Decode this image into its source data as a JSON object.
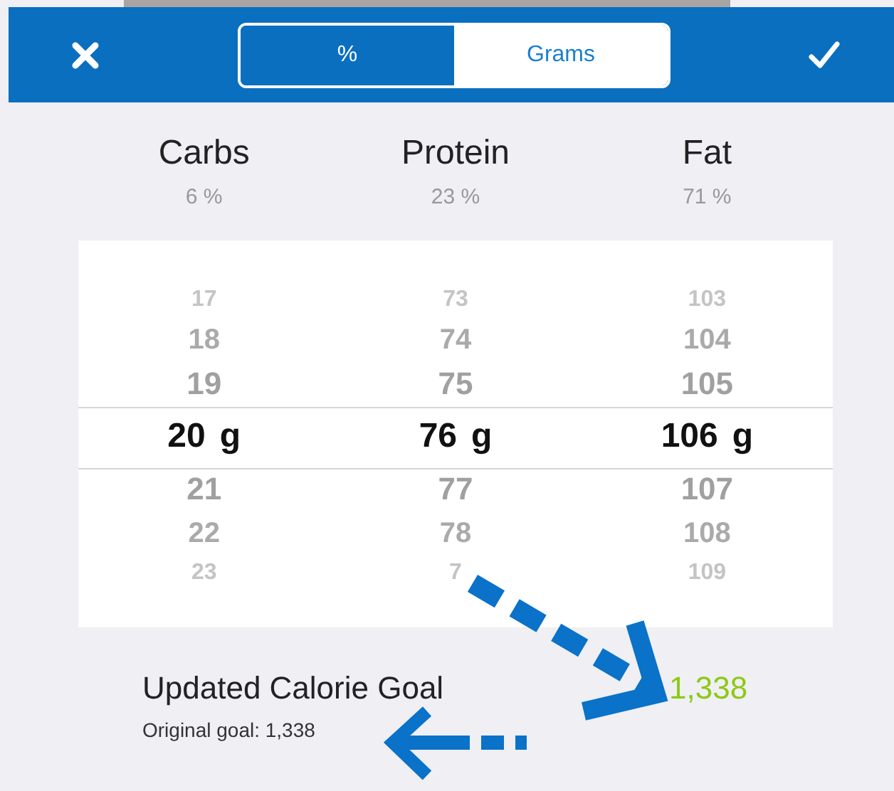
{
  "segments": [
    {
      "label": "%",
      "selected": true
    },
    {
      "label": "Grams",
      "selected": false
    }
  ],
  "macros": [
    {
      "name": "Carbs",
      "percent": "6 %",
      "unit": "g",
      "values": [
        {
          "value": "17",
          "selected": false
        },
        {
          "value": "18",
          "selected": false
        },
        {
          "value": "19",
          "selected": false
        },
        {
          "value": "20",
          "selected": true
        },
        {
          "value": "21",
          "selected": false
        },
        {
          "value": "22",
          "selected": false
        },
        {
          "value": "23",
          "selected": false
        }
      ]
    },
    {
      "name": "Protein",
      "percent": "23 %",
      "unit": "g",
      "values": [
        {
          "value": "73",
          "selected": false
        },
        {
          "value": "74",
          "selected": false
        },
        {
          "value": "75",
          "selected": false
        },
        {
          "value": "76",
          "selected": true
        },
        {
          "value": "77",
          "selected": false
        },
        {
          "value": "78",
          "selected": false
        },
        {
          "value": "7",
          "selected": false
        }
      ]
    },
    {
      "name": "Fat",
      "percent": "71 %",
      "unit": "g",
      "values": [
        {
          "value": "103",
          "selected": false
        },
        {
          "value": "104",
          "selected": false
        },
        {
          "value": "105",
          "selected": false
        },
        {
          "value": "106",
          "selected": true
        },
        {
          "value": "107",
          "selected": false
        },
        {
          "value": "108",
          "selected": false
        },
        {
          "value": "109",
          "selected": false
        }
      ]
    }
  ],
  "goal": {
    "title": "Updated Calorie Goal",
    "value": "1,338",
    "original": "Original goal: 1,338"
  }
}
